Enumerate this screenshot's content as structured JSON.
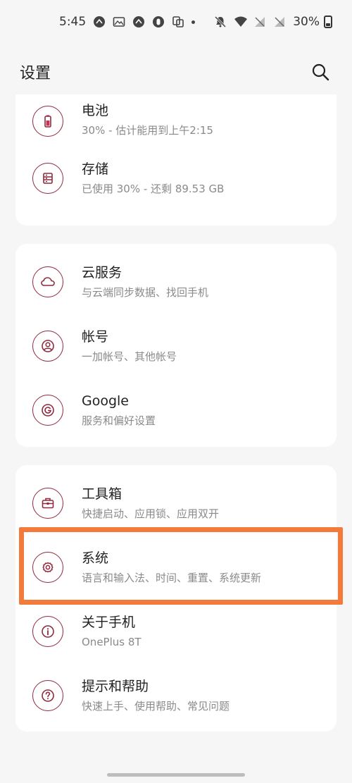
{
  "status_bar": {
    "time": "5:45",
    "battery_text": "30%"
  },
  "header": {
    "title": "设置"
  },
  "groups": [
    {
      "items": [
        {
          "title": "电池",
          "subtitle": "30% - 估计能用到上午2:15",
          "icon": "battery-icon"
        },
        {
          "title": "存储",
          "subtitle": "已使用 30% - 还剩 89.53 GB",
          "icon": "storage-icon"
        }
      ]
    },
    {
      "items": [
        {
          "title": "云服务",
          "subtitle": "与云端同步数据、找回手机",
          "icon": "cloud-icon"
        },
        {
          "title": "帐号",
          "subtitle": "一加帐号、其他帐号",
          "icon": "account-icon"
        },
        {
          "title": "Google",
          "subtitle": "服务和偏好设置",
          "icon": "google-icon"
        }
      ]
    },
    {
      "items": [
        {
          "title": "工具箱",
          "subtitle": "快捷启动、应用锁、应用双开",
          "icon": "toolbox-icon"
        },
        {
          "title": "系统",
          "subtitle": "语言和输入法、时间、重置、系统更新",
          "icon": "gear-icon"
        },
        {
          "title": "关于手机",
          "subtitle": "OnePlus 8T",
          "icon": "info-icon"
        },
        {
          "title": "提示和帮助",
          "subtitle": "快速上手、使用帮助、常见问题",
          "icon": "help-icon"
        }
      ]
    }
  ],
  "colors": {
    "accent": "#8f2a3f",
    "highlight": "#f27a3a",
    "background": "#f6f6f6",
    "card": "#ffffff",
    "subtitle": "#8a8a8a"
  }
}
